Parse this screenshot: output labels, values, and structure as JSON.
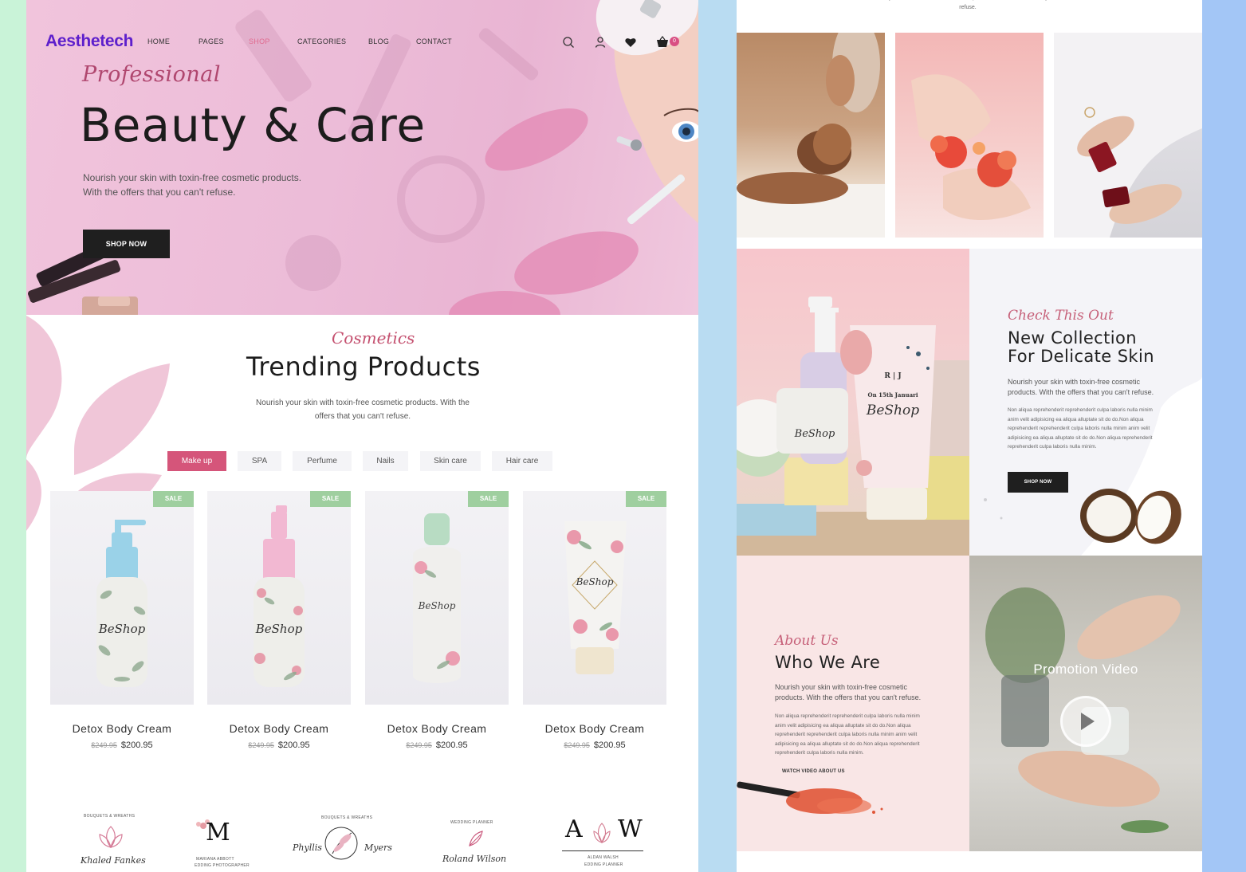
{
  "header": {
    "logo": "Aesthetech",
    "nav": [
      {
        "label": "HOME",
        "active": false
      },
      {
        "label": "PAGES",
        "active": false
      },
      {
        "label": "SHOP",
        "active": true
      },
      {
        "label": "CATEGORIES",
        "active": false
      },
      {
        "label": "BLOG",
        "active": false
      },
      {
        "label": "CONTACT",
        "active": false
      }
    ],
    "icons": [
      "search-icon",
      "user-icon",
      "heart-icon",
      "basket-icon"
    ],
    "cart_count": "0"
  },
  "hero": {
    "script": "Professional",
    "title": "Beauty & Care",
    "subtitle": "Nourish your skin with toxin-free cosmetic products. With the offers that you can't refuse.",
    "button": "SHOP NOW"
  },
  "trending": {
    "script": "Cosmetics",
    "title": "Trending Products",
    "subtitle": "Nourish your skin with toxin-free cosmetic products. With the offers that you can't refuse.",
    "tabs": [
      {
        "label": "Make up",
        "active": true
      },
      {
        "label": "SPA",
        "active": false
      },
      {
        "label": "Perfume",
        "active": false
      },
      {
        "label": "Nails",
        "active": false
      },
      {
        "label": "Skin care",
        "active": false
      },
      {
        "label": "Hair care",
        "active": false
      }
    ],
    "products": [
      {
        "name": "Detox Body Cream",
        "old_price": "$249.95",
        "price": "$200.95",
        "badge": "SALE",
        "brand": "BeShop"
      },
      {
        "name": "Detox Body Cream",
        "old_price": "$249.95",
        "price": "$200.95",
        "badge": "SALE",
        "brand": "BeShop"
      },
      {
        "name": "Detox Body Cream",
        "old_price": "$249.95",
        "price": "$200.95",
        "badge": "SALE",
        "brand": "BeShop"
      },
      {
        "name": "Detox Body Cream",
        "old_price": "$249.95",
        "price": "$200.95",
        "badge": "SALE",
        "brand": "BeShop"
      }
    ]
  },
  "partners": [
    {
      "top": "BOUQUETS & WREATHS",
      "name": "Khaled Fankes"
    },
    {
      "initial": "M",
      "name": "MARIANA ABBOTT",
      "sub": "EDDING PHOTOGRAPHER"
    },
    {
      "top": "BOUQUETS & WREATHS",
      "first": "Phyllis",
      "last": "Myers"
    },
    {
      "top": "WEDDING PLANNER",
      "name": "Roland Wilson"
    },
    {
      "left": "A",
      "right": "W",
      "name": "ALDAN WALSH",
      "sub": "EDDING PLANNER"
    }
  ],
  "right_page": {
    "top_text": "Nourish your skin with toxin-free cosmetic products. With the offers that you can't refuse.",
    "collection": {
      "script": "Check This Out",
      "title_line1": "New Collection",
      "title_line2": "For Delicate Skin",
      "subtitle": "Nourish your skin with toxin-free cosmetic products. With the offers that you can't refuse.",
      "body": "Non aliqua reprehenderit reprehenderit culpa laboris nulla minim anim velit adipisicing ea aliqua alluptate sit do do.Non aliqua reprehenderit reprehenderit culpa laboris nulla minim anim velit adipisicing ea aliqua alluptate sit do do.Non aliqua reprehenderit reprehenderit culpa laboris nulla minim.",
      "button": "SHOP NOW",
      "tube_brand": "BeShop",
      "tube_label": "R | J",
      "tube_date": "On 15th Januari"
    },
    "about": {
      "script": "About Us",
      "title": "Who We Are",
      "subtitle": "Nourish your skin with toxin-free cosmetic products. With the offers that you can't refuse.",
      "body": "Non aliqua reprehenderit reprehenderit culpa laboris nulla minim anim velit adipisicing ea aliqua alluptate sit do do.Non aliqua reprehenderit reprehenderit culpa laboris nulla minim anim velit adipisicing ea aliqua alluptate sit do do.Non aliqua reprehenderit reprehenderit culpa laboris nulla minim.",
      "link": "WATCH VIDEO ABOUT US"
    },
    "video": {
      "title": "Promotion Video"
    }
  },
  "colors": {
    "brand": "#5d1fcc",
    "accent": "#d5557a",
    "sale": "#9fcf9f",
    "dark": "#1f1f1f"
  }
}
